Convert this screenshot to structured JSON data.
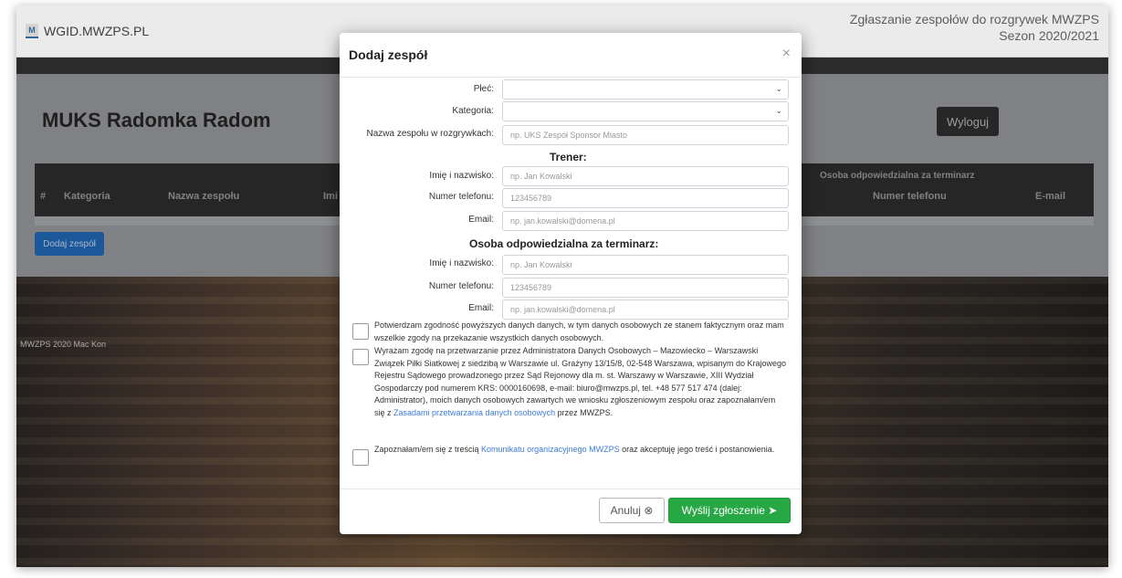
{
  "background": {
    "brand": "WGID.MWZPS.PL",
    "brand_logo": "M",
    "header_title_line1": "Zgłaszanie zespołów do rozgrywek MWZPS",
    "header_title_line2": "Sezon 2020/2021",
    "club_name": "MUKS Radomka Radom",
    "logout_label": "Wyloguj",
    "table": {
      "group_header": "Osoba odpowiedzialna za terminarz",
      "columns": [
        "#",
        "Kategoria",
        "Nazwa zespołu",
        "Imi",
        "Numer telefonu",
        "E-mail"
      ]
    },
    "add_team_label": "Dodaj zespół",
    "footer_text": "MWZPS 2020 Mac Kon"
  },
  "modal": {
    "title": "Dodaj zespół",
    "close": "×",
    "fields": {
      "gender_label": "Płeć:",
      "category_label": "Kategoria:",
      "team_name_label": "Nazwa zespołu w rozgrywkach:",
      "team_name_placeholder": "np. UKS Zespół Sponsor Miasto"
    },
    "coach": {
      "heading": "Trener:",
      "name_label": "Imię i nazwisko:",
      "name_placeholder": "np. Jan Kowalski",
      "phone_label": "Numer telefonu:",
      "phone_placeholder": "123456789",
      "email_label": "Email:",
      "email_placeholder": "np. jan.kowalski@domena.pl"
    },
    "scheduler": {
      "heading": "Osoba odpowiedzialna za terminarz:",
      "name_label": "Imię i nazwisko:",
      "name_placeholder": "np. Jan Kowalski",
      "phone_label": "Numer telefonu:",
      "phone_placeholder": "123456789",
      "email_label": "Email:",
      "email_placeholder": "np. jan.kowalski@domena.pl"
    },
    "consents": {
      "c1": "Potwierdzam zgodność powyższych danych danych, w tym danych osobowych ze stanem faktycznym oraz mam wszelkie zgody na przekazanie wszystkich danych osobowych.",
      "c2_text": "Wyrażam zgodę na przetwarzanie przez Administratora Danych Osobowych – Mazowiecko – Warszawski Związek Piłki Siatkowej z siedzibą w Warszawie ul. Grażyny 13/15/8, 02-548 Warszawa, wpisanym do Krajowego Rejestru Sądowego prowadzonego przez Sąd Rejonowy dla m. st. Warszawy w Warszawie, XIII Wydział Gospodarczy pod numerem KRS: 0000160698, e-mail: biuro@mwzps.pl, tel. +48 577 517 474 (dalej: Administrator), moich danych osobowych zawartych we wniosku zgłoszeniowym zespołu oraz zapoznałam/em się z ",
      "c2_link": "Zasadami przetwarzania danych osobowych",
      "c2_tail": " przez MWZPS.",
      "c3_text": "Zapoznałam/em się z treścią ",
      "c3_link": "Komunikatu organizacyjnego MWZPS",
      "c3_tail": " oraz akceptuję jego treść i postanowienia."
    },
    "cancel_label": "Anuluj",
    "cancel_icon": "⊗",
    "send_label": "Wyślij zgłoszenie",
    "send_icon": "➤"
  }
}
